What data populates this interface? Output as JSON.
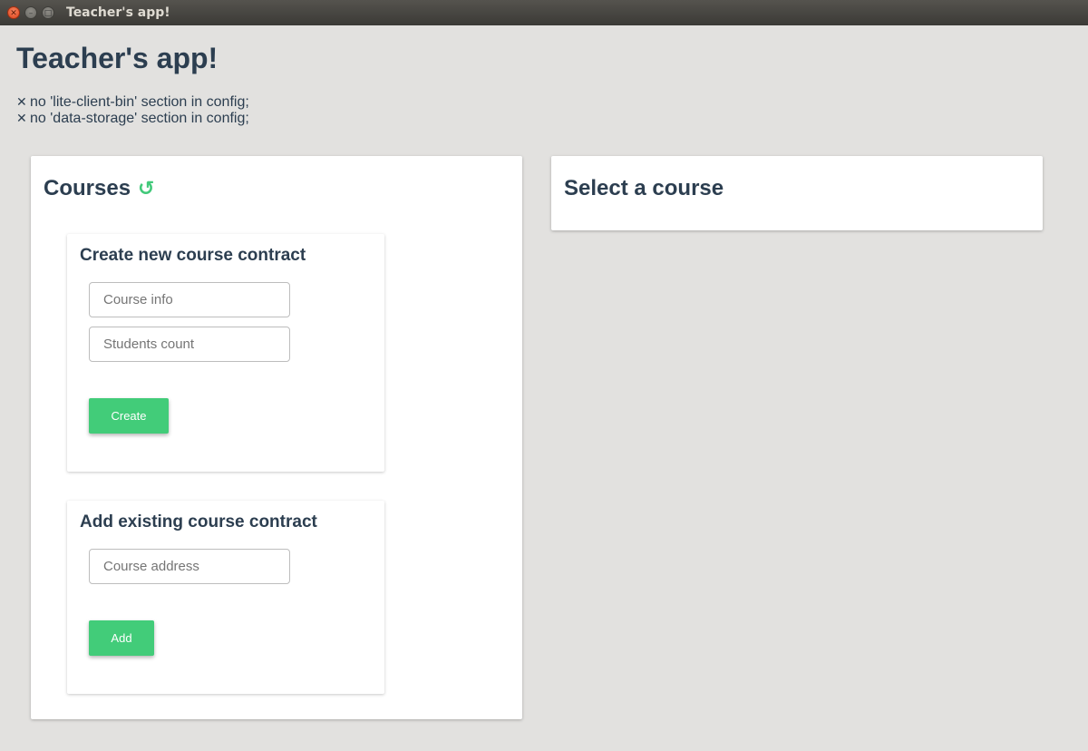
{
  "window": {
    "title": "Teacher's app!"
  },
  "app": {
    "title": "Teacher's app!"
  },
  "errors": [
    "no 'lite-client-bin' section in config;",
    "no 'data-storage' section in config;"
  ],
  "courses": {
    "heading": "Courses",
    "refresh_icon": "refresh-icon",
    "create": {
      "heading": "Create new course contract",
      "course_info_placeholder": "Course info",
      "students_count_placeholder": "Students count",
      "button_label": "Create"
    },
    "add": {
      "heading": "Add existing course contract",
      "course_address_placeholder": "Course address",
      "button_label": "Add"
    }
  },
  "details": {
    "heading": "Select a course"
  },
  "colors": {
    "accent": "#42cc79",
    "text": "#2c3e50",
    "background": "#e2e1df"
  }
}
